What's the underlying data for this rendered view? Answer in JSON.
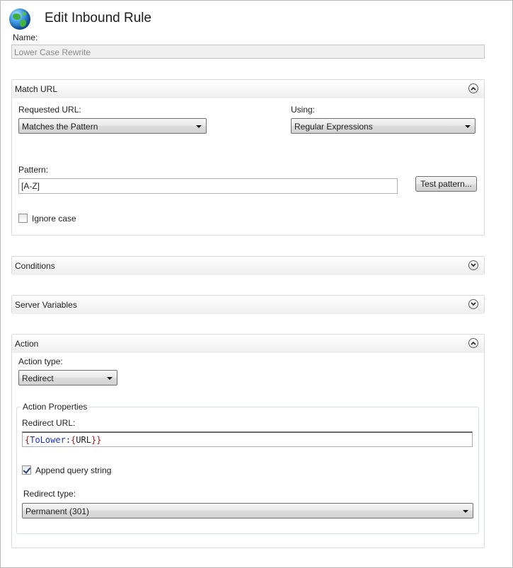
{
  "header": {
    "title": "Edit Inbound Rule",
    "icon": "globe-icon"
  },
  "name_field": {
    "label": "Name:",
    "value": "Lower Case Rewrite"
  },
  "match_url": {
    "title": "Match URL",
    "requested_url_label": "Requested URL:",
    "requested_url_value": "Matches the Pattern",
    "using_label": "Using:",
    "using_value": "Regular Expressions",
    "pattern_label": "Pattern:",
    "pattern_value": "[A-Z]",
    "test_pattern_button": "Test pattern...",
    "ignore_case_label": "Ignore case",
    "ignore_case_checked": false
  },
  "conditions": {
    "title": "Conditions"
  },
  "server_variables": {
    "title": "Server Variables"
  },
  "action": {
    "title": "Action",
    "action_type_label": "Action type:",
    "action_type_value": "Redirect",
    "properties_legend": "Action Properties",
    "redirect_url_label": "Redirect URL:",
    "redirect_url_tokens": {
      "open1": "{",
      "fn": "ToLower",
      "colon": ":",
      "open2": "{",
      "var": "URL",
      "close": "}}"
    },
    "append_query_label": "Append query string",
    "append_query_checked": true,
    "redirect_type_label": "Redirect type:",
    "redirect_type_value": "Permanent (301)"
  },
  "colors": {
    "fn_token": "#1a30c8",
    "brace_token": "#a31515",
    "section_border": "#d9d9d9"
  }
}
